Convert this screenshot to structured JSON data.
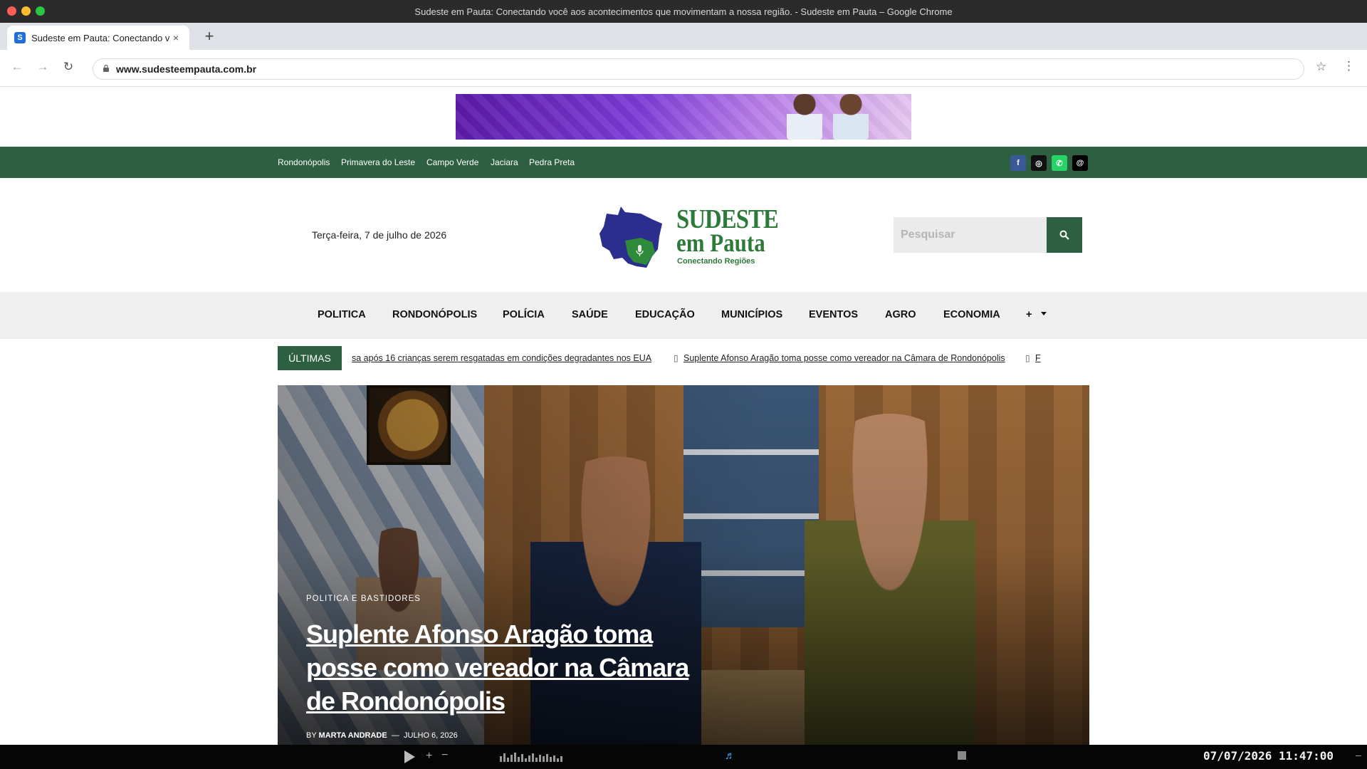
{
  "window": {
    "title": "Sudeste em Pauta: Conectando você aos acontecimentos que movimentam a nossa região. - Sudeste em Pauta – Google Chrome"
  },
  "tab": {
    "favicon_letter": "S",
    "title": "Sudeste em Pauta: Conectando v...",
    "close_icon": "×",
    "new_tab_icon": "+"
  },
  "toolbar": {
    "back_icon": "←",
    "forward_icon": "→",
    "reload_icon": "↻",
    "url": "www.sudesteempauta.com.br",
    "star_icon": "☆",
    "menu_icon": "⋮"
  },
  "topbar": {
    "cities": [
      "Rondonópolis",
      "Primavera do Leste",
      "Campo Verde",
      "Jaciara",
      "Pedra Preta"
    ],
    "social_icons": [
      "facebook-icon",
      "instagram-icon",
      "whatsapp-icon",
      "threads-icon"
    ],
    "social_glyphs": [
      "f",
      "◎",
      "✆",
      "@"
    ]
  },
  "header": {
    "date": "Terça-feira, 7 de julho de 2026",
    "logo_line1": "SUDESTE",
    "logo_line2": "em Pauta",
    "logo_tagline": "Conectando Regiões",
    "search_placeholder": "Pesquisar",
    "search_icon": "search-icon"
  },
  "nav": {
    "items": [
      "POLITICA",
      "RONDONÓPOLIS",
      "POLÍCIA",
      "SAÚDE",
      "EDUCAÇÃO",
      "MUNICÍPIOS",
      "EVENTOS",
      "AGRO",
      "ECONOMIA",
      "+"
    ]
  },
  "ticker": {
    "label": "ÚLTIMAS",
    "items": [
      "sa após 16 crianças serem resgatadas em condições degradantes nos EUA",
      "Suplente Afonso Aragão toma posse como vereador na Câmara de Rondonópolis",
      "F"
    ]
  },
  "hero": {
    "category": "POLITICA E BASTIDORES",
    "title": "Suplente Afonso Aragão toma posse como vereador na Câmara de Rondonópolis",
    "by_prefix": "BY",
    "author": "MARTA ANDRADE",
    "separator": "—",
    "date": "JULHO 6, 2026"
  },
  "system": {
    "clock": "07/07/2026 11:47:00",
    "plus": "+",
    "minus": "−",
    "note_icon": "♬",
    "dash": "–"
  },
  "colors": {
    "brand_green": "#2c6040",
    "logo_green": "#2c7a3a",
    "logo_blue": "#2b2e8c"
  }
}
